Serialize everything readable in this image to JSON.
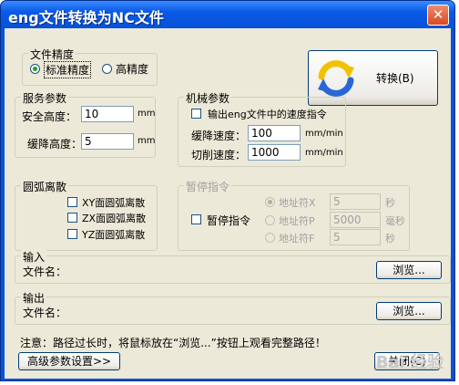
{
  "window": {
    "title": "eng文件转换为NC文件",
    "close_glyph": "✕"
  },
  "precision": {
    "legend": "文件精度",
    "options": [
      {
        "label": "标准精度",
        "selected": true
      },
      {
        "label": "高精度",
        "selected": false
      }
    ]
  },
  "convert_button": {
    "label": "转换(B)"
  },
  "service": {
    "legend": "服务参数",
    "safe_height_label": "安全高度：",
    "safe_height_value": "10",
    "safe_height_unit": "mm",
    "slow_height_label": "缓降高度：",
    "slow_height_value": "5",
    "slow_height_unit": "mm"
  },
  "machine": {
    "legend": "机械参数",
    "output_speed_label": "输出eng文件中的速度指令",
    "slow_speed_label": "缓降速度：",
    "slow_speed_value": "100",
    "slow_speed_unit": "mm/min",
    "cut_speed_label": "切削速度：",
    "cut_speed_value": "1000",
    "cut_speed_unit": "mm/min"
  },
  "arc": {
    "legend": "圆弧离散",
    "items": [
      "XY面圆弧离散",
      "ZX面圆弧离散",
      "YZ面圆弧离散"
    ]
  },
  "pause": {
    "legend": "暂停指令",
    "checkbox_label": "暂停指令",
    "rows": [
      {
        "label": "地址符X",
        "value": "5",
        "unit": "秒"
      },
      {
        "label": "地址符P",
        "value": "5000",
        "unit": "毫秒"
      },
      {
        "label": "地址符F",
        "value": "5",
        "unit": "秒"
      }
    ]
  },
  "input": {
    "legend": "输入",
    "file_label": "文件名：",
    "browse": "浏览..."
  },
  "output": {
    "legend": "输出",
    "file_label": "文件名：",
    "browse": "浏览..."
  },
  "note": "注意：路径过长时，将鼠标放在“浏览...”按钮上观看完整路径！",
  "advanced_button": "高级参数设置>>",
  "close_button": "关闭(C)",
  "watermark": "Bai 经验"
}
